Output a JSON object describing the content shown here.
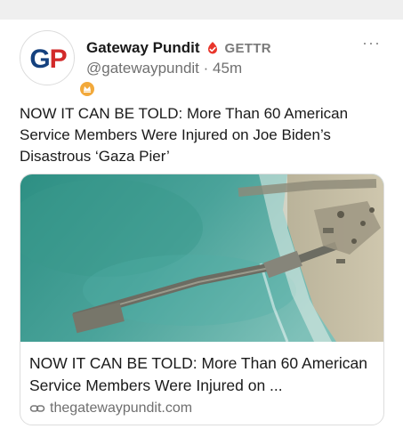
{
  "post": {
    "author": {
      "avatar_text": "GP",
      "name": "Gateway Pundit",
      "platform": "GETTR",
      "handle": "@gatewaypundit",
      "separator": "·",
      "time": "45m"
    },
    "text": "NOW IT CAN BE TOLD: More Than 60 American Service Members Were Injured on Joe Biden’s Disastrous ‘Gaza Pier’",
    "more_icon": "more-horizontal-icon",
    "link_card": {
      "image": "aerial-view-gaza-pier-photo",
      "title": "NOW IT CAN BE TOLD: More Than 60 American Service Members Were Injured on ...",
      "domain": "thegatewaypundit.com",
      "link_icon": "link-icon"
    }
  },
  "colors": {
    "verified": "#e8352b",
    "badge": "#f2a93b",
    "logo_blue": "#15417e",
    "logo_red": "#d22a2a"
  }
}
